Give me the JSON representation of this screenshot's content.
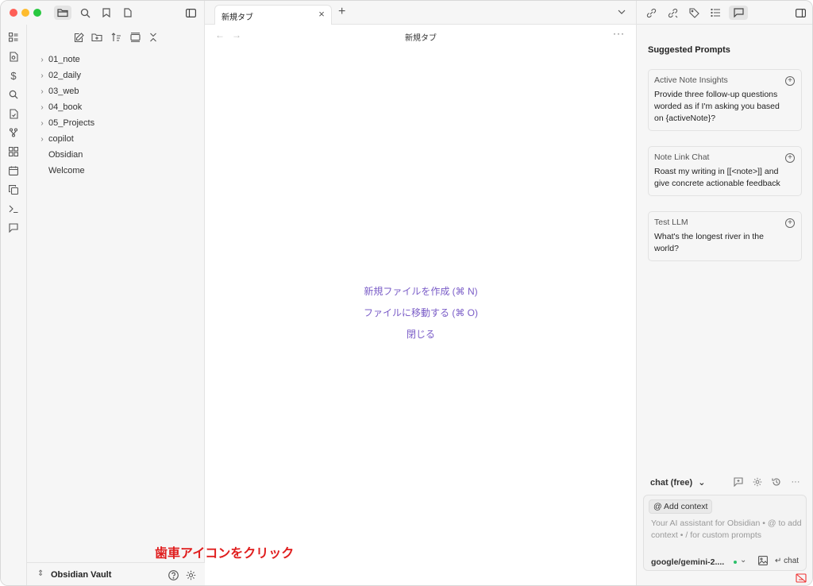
{
  "window": {
    "traffic_lights": {
      "close": "#fe5f57",
      "minimize": "#febc2e",
      "zoom": "#28c840"
    }
  },
  "ribbon": {
    "icons": [
      "dashboard-icon",
      "note-search-icon",
      "dollar-icon",
      "search-icon",
      "file-check-icon",
      "git-branch-icon",
      "grid-icon",
      "calendar-icon",
      "copy-icon",
      "terminal-icon",
      "chat-bubble-icon"
    ]
  },
  "sidebar": {
    "tree": [
      {
        "label": "01_note",
        "folder": true
      },
      {
        "label": "02_daily",
        "folder": true
      },
      {
        "label": "03_web",
        "folder": true
      },
      {
        "label": "04_book",
        "folder": true
      },
      {
        "label": "05_Projects",
        "folder": true
      },
      {
        "label": "copilot",
        "folder": true
      },
      {
        "label": "Obsidian",
        "folder": false
      },
      {
        "label": "Welcome",
        "folder": false
      }
    ],
    "vault_name": "Obsidian Vault"
  },
  "tabs": {
    "active_label": "新規タブ"
  },
  "editor": {
    "title": "新規タブ",
    "actions": {
      "create": "新規ファイルを作成 (⌘ N)",
      "goto": "ファイルに移動する (⌘ O)",
      "close": "閉じる"
    }
  },
  "copilot": {
    "section_title": "Suggested Prompts",
    "prompts": [
      {
        "title": "Active Note Insights",
        "text": "Provide three follow-up questions worded as if I'm asking you based on {activeNote}?"
      },
      {
        "title": "Note Link Chat",
        "text": "Roast my writing in [[<note>]] and give concrete actionable feedback"
      },
      {
        "title": "Test LLM",
        "text": "What's the longest river in the world?"
      }
    ],
    "mode": "chat (free)",
    "add_context": "@ Add context",
    "placeholder": "Your AI assistant for Obsidian • @ to add context • / for custom prompts",
    "model": "google/gemini-2....",
    "send_label": "↵ chat"
  },
  "annotation": {
    "text": "歯車アイコンをクリック",
    "color": "#e01e1e"
  },
  "colors": {
    "accent": "#7a5cc7",
    "sidebar_bg": "#f6f6f6"
  }
}
